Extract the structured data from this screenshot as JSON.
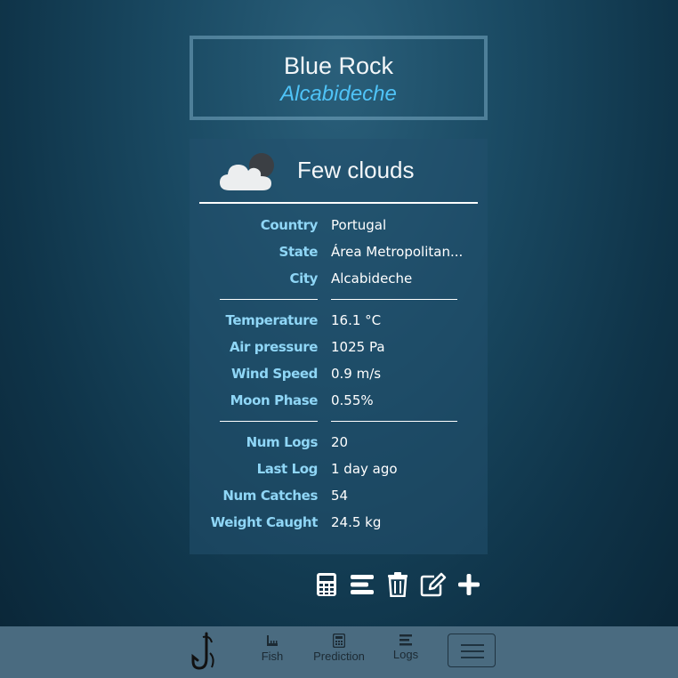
{
  "spot": {
    "name": "Blue Rock",
    "town": "Alcabideche"
  },
  "weather": {
    "description": "Few clouds",
    "icon": "cloud-moon-icon"
  },
  "location": [
    {
      "label": "Country",
      "value": "Portugal"
    },
    {
      "label": "State",
      "value": "Área Metropolitan..."
    },
    {
      "label": "City",
      "value": "Alcabideche"
    }
  ],
  "conditions": [
    {
      "label": "Temperature",
      "value": "16.1 °C"
    },
    {
      "label": "Air pressure",
      "value": "1025 Pa"
    },
    {
      "label": "Wind Speed",
      "value": "0.9 m/s"
    },
    {
      "label": "Moon Phase",
      "value": "0.55%"
    }
  ],
  "stats": [
    {
      "label": "Num Logs",
      "value": "20"
    },
    {
      "label": "Last Log",
      "value": "1 day ago"
    },
    {
      "label": "Num Catches",
      "value": "54"
    },
    {
      "label": "Weight Caught",
      "value": "24.5 kg"
    }
  ],
  "actions": [
    "calculator-icon",
    "list-icon",
    "trash-icon",
    "edit-icon",
    "plus-icon"
  ],
  "nav": {
    "items": [
      {
        "label": "Fish",
        "icon": "ruler-icon"
      },
      {
        "label": "Prediction",
        "icon": "calculator-icon"
      },
      {
        "label": "Logs",
        "icon": "list-icon"
      }
    ],
    "logo_icon": "fishhook-icon"
  },
  "colors": {
    "accent": "#4fc3f7",
    "label": "#8fd6f6",
    "navbar": "#4a6b80"
  }
}
